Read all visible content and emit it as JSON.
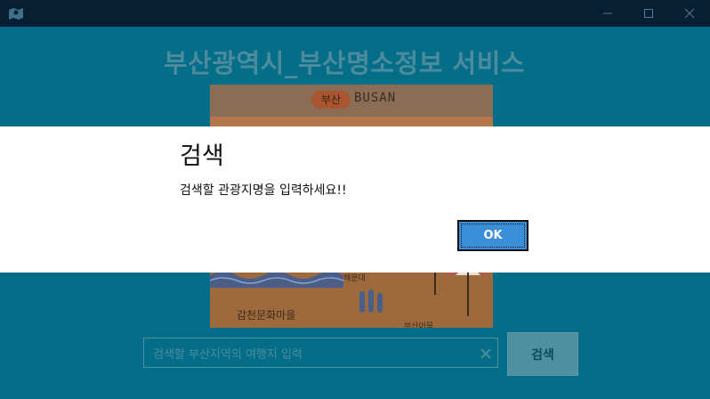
{
  "window": {
    "app_icon": "map-icon",
    "minimize_icon": "minimize-icon",
    "maximize_icon": "maximize-icon",
    "close_icon": "close-icon"
  },
  "main": {
    "title": "부산광역시_부산명소정보 서비스",
    "poster": {
      "tag": "부산",
      "brand": "BUSAN",
      "label_right": "해운대",
      "label_bottom_right": "부산어묵",
      "caption": "감천문화마을"
    },
    "search": {
      "placeholder": "검색할 부산지역의 여행지 입력",
      "button_label": "검색",
      "clear_icon": "clear-icon"
    }
  },
  "dialog": {
    "title": "검색",
    "message": "검색할 관광지명을 입력하세요!!",
    "ok_label": "OK"
  },
  "colors": {
    "titlebar": "#061f33",
    "background": "#046e89",
    "dialog_bg": "#ffffff",
    "ok_button": "#3b8fd9"
  }
}
